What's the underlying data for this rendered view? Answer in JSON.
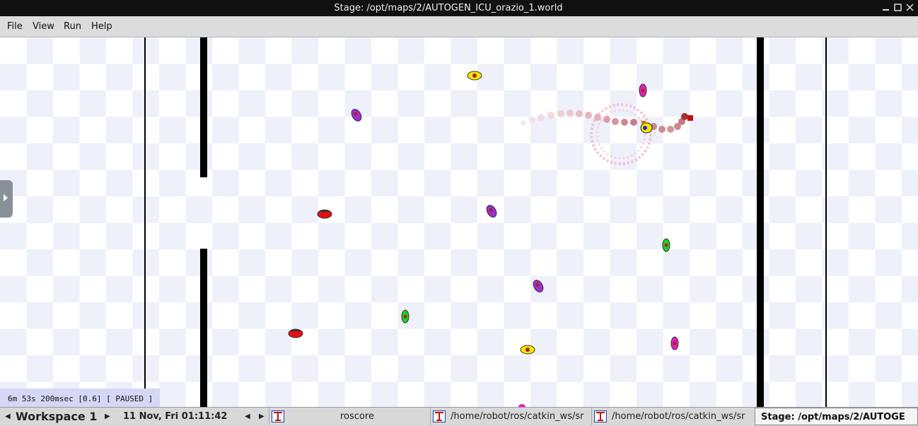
{
  "window": {
    "title": "Stage: /opt/maps/2/AUTOGEN_ICU_orazio_1.world",
    "minimize_icon": "minimize-icon",
    "maximize_icon": "maximize-icon",
    "close_icon": "close-icon"
  },
  "menu": {
    "file": "File",
    "view": "View",
    "run": "Run",
    "help": "Help"
  },
  "status": {
    "time": "6m 53s 200msec [0.6] [ PAUSED ]"
  },
  "taskbar": {
    "workspace": "Workspace 1",
    "datetime": "11 Nov, Fri 01:11:42",
    "tasks": [
      {
        "label": "roscore",
        "icon": "xterm-icon"
      },
      {
        "label": "/home/robot/ros/catkin_ws/sr",
        "icon": "xterm-icon"
      },
      {
        "label": "/home/robot/ros/catkin_ws/sr",
        "icon": "xterm-icon"
      },
      {
        "label": "Stage: /opt/maps/2/AUTOGE",
        "icon": "stage-icon"
      }
    ]
  },
  "colors": {
    "red": "#e01010",
    "yellow": "#f5e600",
    "magenta": "#e020c0",
    "purple": "#9a30d0",
    "green": "#20d020",
    "wall": "#000000",
    "trail": "#e8a0a8"
  }
}
